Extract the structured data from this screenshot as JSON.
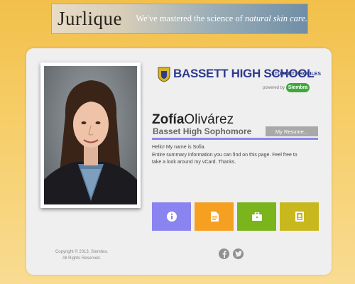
{
  "ad": {
    "brand": "Jurlique",
    "tagline_prefix": "We've mastered the science of ",
    "tagline_emphasis": "natural skin care."
  },
  "profile": {
    "school_name": "BASSETT HIGH SCHOOL",
    "school_subtitle": "STUDENT PROFILES",
    "powered_by": "powered by",
    "powered_brand": "Siembra",
    "first_name": "Zofía",
    "last_name": "Olivárez",
    "subtitle": "Basset High Sophomore",
    "resume_label": "My Resume...",
    "bio_lines": [
      "Hello! My name is Sofia.",
      "Entire summary information you can find on this page. Feel free to",
      "take a look around my vCard. Thanks."
    ]
  },
  "tiles": [
    {
      "icon": "info-icon",
      "color": "#8a84f0"
    },
    {
      "icon": "document-icon",
      "color": "#f6a021"
    },
    {
      "icon": "briefcase-icon",
      "color": "#7ab51d"
    },
    {
      "icon": "portfolio-icon",
      "color": "#c9b81d"
    }
  ],
  "footer": {
    "copyright_line1": "Copyright © 2013, Siembra.",
    "copyright_line2": "All Rights Reserved."
  },
  "social": [
    {
      "icon": "facebook-icon"
    },
    {
      "icon": "twitter-icon"
    }
  ]
}
